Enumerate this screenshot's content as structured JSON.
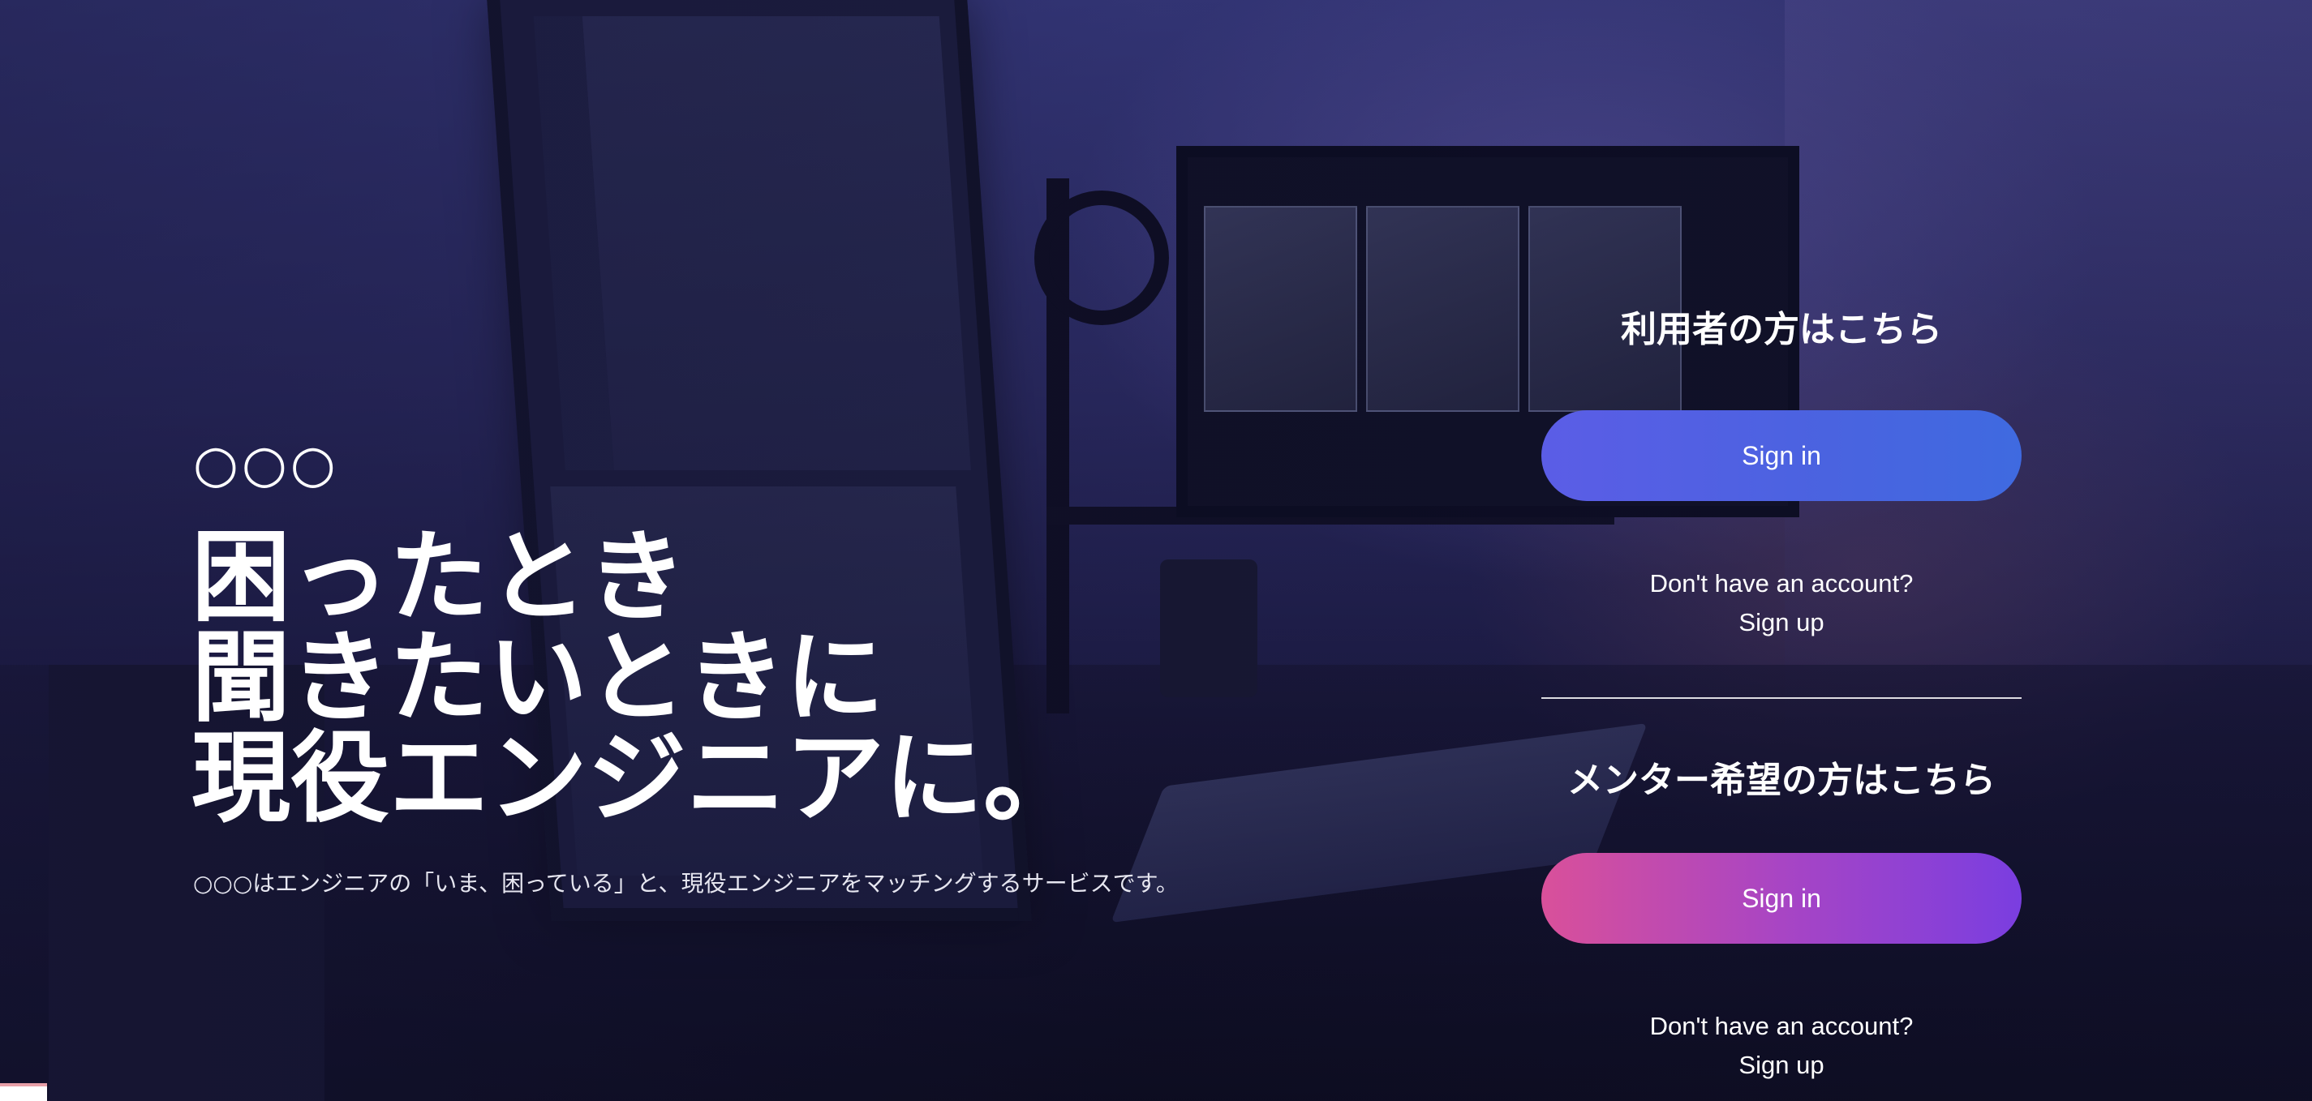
{
  "hero": {
    "brand": "○○○",
    "headline": [
      "困ったとき",
      "聞きたいときに",
      "現役エンジニアに。"
    ],
    "description": "○○○はエンジニアの「いま、困っている」と、現役エンジニアをマッチングするサービスです。"
  },
  "user_section": {
    "title": "利用者の方はこちら",
    "sign_in_label": "Sign in",
    "no_account_text": "Don't have an account?",
    "sign_up_label": "Sign up"
  },
  "mentor_section": {
    "title": "メンター希望の方はこちら",
    "sign_in_label": "Sign in",
    "no_account_text": "Don't have an account?",
    "sign_up_label": "Sign up"
  },
  "colors": {
    "user_button_gradient": [
      "#5b5de6",
      "#3f6ae0"
    ],
    "mentor_button_gradient": [
      "#d9509a",
      "#7a3ee0"
    ],
    "text": "#ffffff"
  },
  "background": {
    "icon": "desk-workstation-photo"
  }
}
